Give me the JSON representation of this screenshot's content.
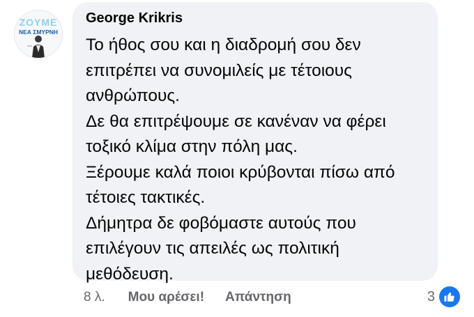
{
  "comment": {
    "author": "George Krikris",
    "avatar_logo_text": [
      "ZOYME",
      "ΝΕΑ ΣΜΥΡΝΗ"
    ],
    "lines": [
      "Το ήθος σου και η διαδρομή σου δεν",
      "επιτρέπει να συνομιλείς με τέτοιους",
      "ανθρώπους.",
      "Δε θα επιτρέψουμε σε κανέναν να φέρει",
      "τοξικό κλίμα στην πόλη μας.",
      "Ξέρουμε καλά ποιοι κρύβονται πίσω από",
      "τέτοιες τακτικές.",
      "Δήμητρα δε φοβόμαστε αυτούς που",
      "επιλέγουν τις απειλές ως πολιτική",
      "μεθόδευση."
    ]
  },
  "actions": {
    "time": "8 λ.",
    "like_label": "Μου αρέσει!",
    "reply_label": "Απάντηση"
  },
  "reactions": {
    "count": "3",
    "icon": "thumbs-up-icon"
  },
  "colors": {
    "bubble_bg": "#f0f2f5",
    "text": "#050505",
    "secondary_text": "#65676b",
    "like_blue": "#1877f2"
  }
}
